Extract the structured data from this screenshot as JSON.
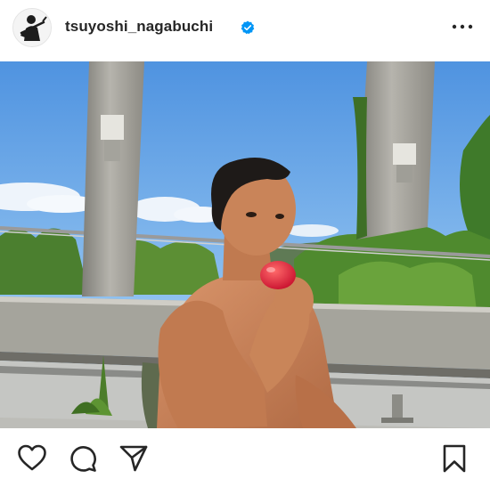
{
  "post": {
    "username": "tsuyoshi_nagabuchi",
    "verified": true,
    "icons": {
      "avatar": "profile-photo-guitarist",
      "verified": "verified-badge-icon",
      "more": "more-options-icon",
      "like": "heart-icon",
      "comment": "comment-icon",
      "share": "share-icon",
      "save": "bookmark-icon"
    }
  },
  "colors": {
    "verified_badge": "#0095f6",
    "icon_stroke": "#262626",
    "sky": "#6fa9e6"
  }
}
